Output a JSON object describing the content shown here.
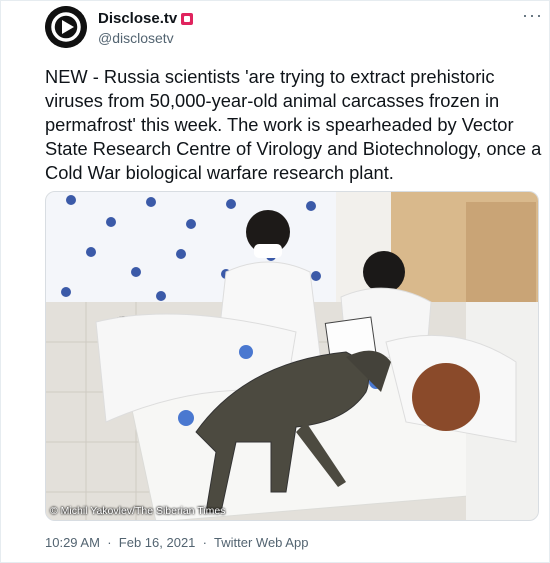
{
  "tweet": {
    "display_name": "Disclose.tv",
    "handle": "@disclosetv",
    "badge_icon": "flag-badge-icon",
    "more_icon": "more-options-icon",
    "text": "NEW - Russia scientists 'are trying to extract prehistoric viruses from 50,000-year-old animal carcasses frozen in permafrost' this week. The work is spearheaded by Vector State Research Centre of Virology and Biotechnology, once a Cold War biological warfare research plant.",
    "media": {
      "credit": "© Michil Yakovlev/The Siberian Times"
    },
    "time": "10:29 AM",
    "date": "Feb 16, 2021",
    "source": "Twitter Web App",
    "separator": "·"
  },
  "colors": {
    "badge": "#e0245e",
    "secondary_text": "#536471",
    "primary_text": "#0f1419"
  }
}
